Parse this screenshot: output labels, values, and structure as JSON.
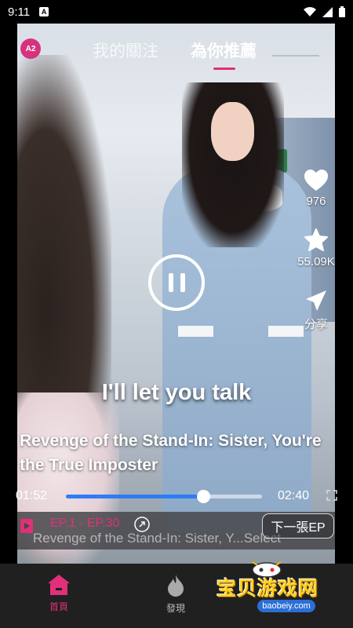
{
  "status_bar": {
    "time": "9:11",
    "notif_letter": "A"
  },
  "top_tabs": {
    "logo_text": "A2",
    "follow": "我的關注",
    "recommend": "為你推薦"
  },
  "side_actions": {
    "like_count": "976",
    "favorite_count": "55.09K",
    "share_label": "分享"
  },
  "player": {
    "subtitle": "I'll let you talk",
    "title_line1": "Revenge of the Stand-In: Sister, You're",
    "title_line2": "the True Imposter",
    "current_time": "01:52",
    "total_time": "02:40",
    "progress": 0.7
  },
  "episode_bar": {
    "range": "EP.1 - EP.30",
    "subtitle": "Revenge of the Stand-In: Sister, Y...Select",
    "next_button": "下一張EP"
  },
  "bottom_nav": {
    "home": "首頁",
    "discover": "發現"
  },
  "watermark": {
    "text": "宝贝游戏网",
    "url": "baobeiy.com"
  },
  "colors": {
    "accent": "#e0307a",
    "progress": "#2f7cf6",
    "nav_bg": "#202020"
  },
  "icons": [
    "heart-icon",
    "star-icon",
    "share-icon",
    "pause-icon",
    "fullscreen-icon",
    "episode-icon",
    "external-link-icon",
    "home-icon",
    "flame-icon"
  ]
}
